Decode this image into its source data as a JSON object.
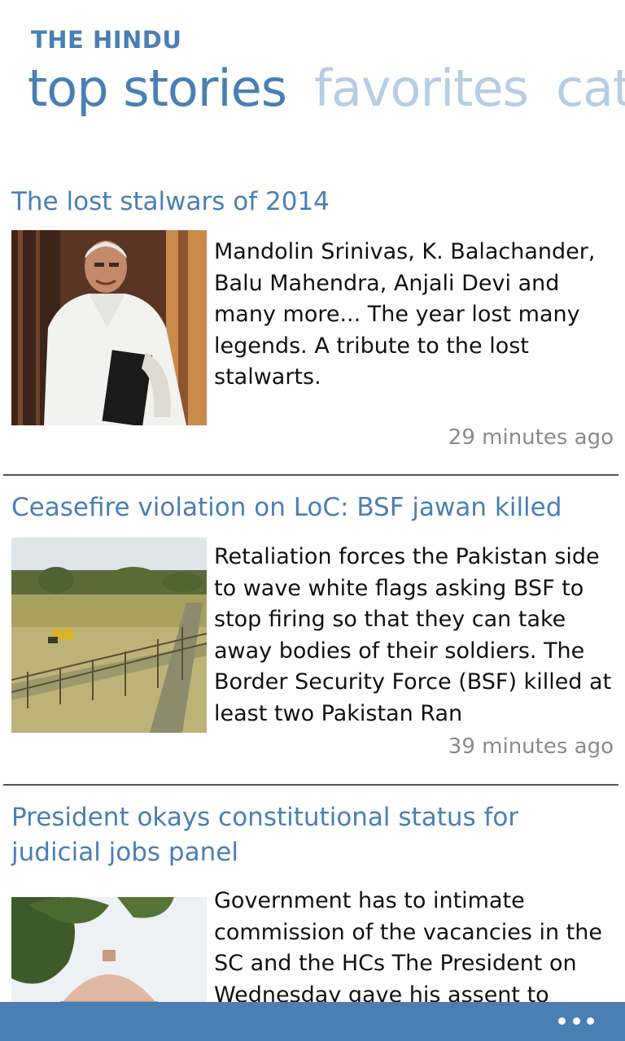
{
  "app": {
    "title": "THE HINDU"
  },
  "pivot": {
    "tabs": [
      {
        "label": "top stories",
        "active": true
      },
      {
        "label": "favorites",
        "active": false
      },
      {
        "label": "categories",
        "active": false
      }
    ]
  },
  "articles": [
    {
      "headline": "The lost stalwars of 2014",
      "summary": "Mandolin Srinivas, K. Balachander, Balu Mahendra, Anjali Devi and many more... The year lost many legends. A tribute to the lost stalwarts.",
      "time": "29 minutes ago",
      "image_icon": "man-portrait-image"
    },
    {
      "headline": "Ceasefire violation on LoC: BSF jawan killed",
      "summary": "Retaliation forces the Pakistan side to wave white flags asking BSF to stop firing so that they can take away bodies of their soldiers. The Border Security Force (BSF) killed at least two Pakistan Ran",
      "time": "39 minutes ago",
      "image_icon": "border-fence-image"
    },
    {
      "headline": "President okays constitutional status for judicial jobs panel",
      "summary": "Government has to intimate commission of the vacancies in the SC and the HCs The President on Wednesday gave his assent to",
      "time": "",
      "image_icon": "supreme-court-dome-image"
    }
  ],
  "appbar": {
    "more_icon": "ellipsis-icon"
  },
  "colors": {
    "accent": "#4a7fb4",
    "inactive_tab": "#b6cde3",
    "timestamp": "#8a8a8a"
  }
}
